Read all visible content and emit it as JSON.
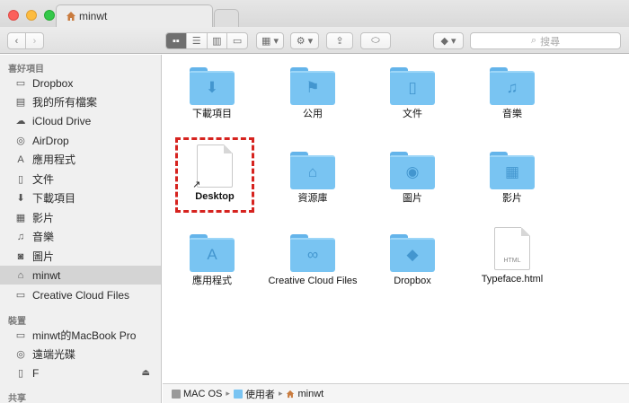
{
  "window": {
    "tab_title": "minwt",
    "search_placeholder": "搜尋"
  },
  "toolbar": {
    "back_icon": "chevron-left-icon",
    "forward_icon": "chevron-right-icon",
    "view_modes": [
      "icon-view",
      "list-view",
      "column-view",
      "cover-flow-view"
    ],
    "active_view": "icon-view"
  },
  "sidebar": {
    "favorites_label": "喜好項目",
    "favorites": [
      {
        "label": "Dropbox",
        "icon": "folder-icon"
      },
      {
        "label": "我的所有檔案",
        "icon": "all-files-icon"
      },
      {
        "label": "iCloud Drive",
        "icon": "cloud-icon"
      },
      {
        "label": "AirDrop",
        "icon": "airdrop-icon"
      },
      {
        "label": "應用程式",
        "icon": "applications-icon"
      },
      {
        "label": "文件",
        "icon": "document-icon"
      },
      {
        "label": "下載項目",
        "icon": "download-icon"
      },
      {
        "label": "影片",
        "icon": "film-icon"
      },
      {
        "label": "音樂",
        "icon": "music-icon"
      },
      {
        "label": "圖片",
        "icon": "camera-icon"
      },
      {
        "label": "minwt",
        "icon": "home-icon"
      },
      {
        "label": "Creative Cloud Files",
        "icon": "folder-icon"
      }
    ],
    "selected_index": 10,
    "devices_label": "裝置",
    "devices": [
      {
        "label": "minwt的MacBook Pro",
        "icon": "laptop-icon"
      },
      {
        "label": "遠端光碟",
        "icon": "disc-icon"
      },
      {
        "label": "F",
        "icon": "drive-icon"
      }
    ],
    "shared_label": "共享"
  },
  "files": [
    {
      "label": "下載項目",
      "kind": "folder",
      "glyph": "⬇"
    },
    {
      "label": "公用",
      "kind": "folder",
      "glyph": "⚑"
    },
    {
      "label": "文件",
      "kind": "folder",
      "glyph": "▯"
    },
    {
      "label": "音樂",
      "kind": "folder",
      "glyph": "♫"
    },
    {
      "label": "Desktop",
      "kind": "alias"
    },
    {
      "label": "資源庫",
      "kind": "folder",
      "glyph": "⌂"
    },
    {
      "label": "圖片",
      "kind": "folder",
      "glyph": "◉"
    },
    {
      "label": "影片",
      "kind": "folder",
      "glyph": "▦"
    },
    {
      "label": "應用程式",
      "kind": "folder",
      "glyph": "A"
    },
    {
      "label": "Creative Cloud Files",
      "kind": "folder",
      "glyph": "∞"
    },
    {
      "label": "Dropbox",
      "kind": "folder",
      "glyph": "◆"
    },
    {
      "label": "Typeface.html",
      "kind": "html",
      "ext": "HTML"
    }
  ],
  "pathbar": [
    "MAC OS",
    "使用者",
    "minwt"
  ]
}
